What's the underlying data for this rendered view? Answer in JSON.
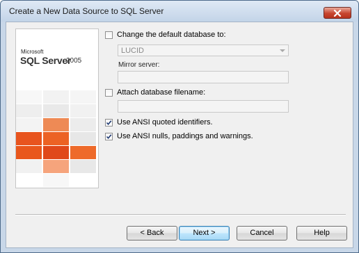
{
  "window": {
    "title": "Create a New Data Source to SQL Server"
  },
  "logo": {
    "small": "Microsoft",
    "brand": "SQL Server",
    "version": "2005"
  },
  "options": {
    "change_db": {
      "label": "Change the default database to:",
      "checked": false
    },
    "database": {
      "value": "LUCID",
      "enabled": false
    },
    "mirror": {
      "label": "Mirror server:",
      "value": ""
    },
    "attach": {
      "label": "Attach database filename:",
      "checked": false,
      "value": ""
    },
    "ansi_quoted": {
      "label": "Use ANSI quoted identifiers.",
      "checked": true
    },
    "ansi_nulls": {
      "label": "Use ANSI nulls, paddings and warnings.",
      "checked": true
    }
  },
  "buttons": {
    "back": "< Back",
    "next": "Next >",
    "cancel": "Cancel",
    "help": "Help"
  },
  "colors": {
    "accent_orange": "#e8541e",
    "title_bar": "#c3d4e8",
    "close_red": "#c7452f"
  },
  "icons": {
    "close": "close-icon",
    "check": "check-icon",
    "dropdown": "chevron-down-icon"
  }
}
